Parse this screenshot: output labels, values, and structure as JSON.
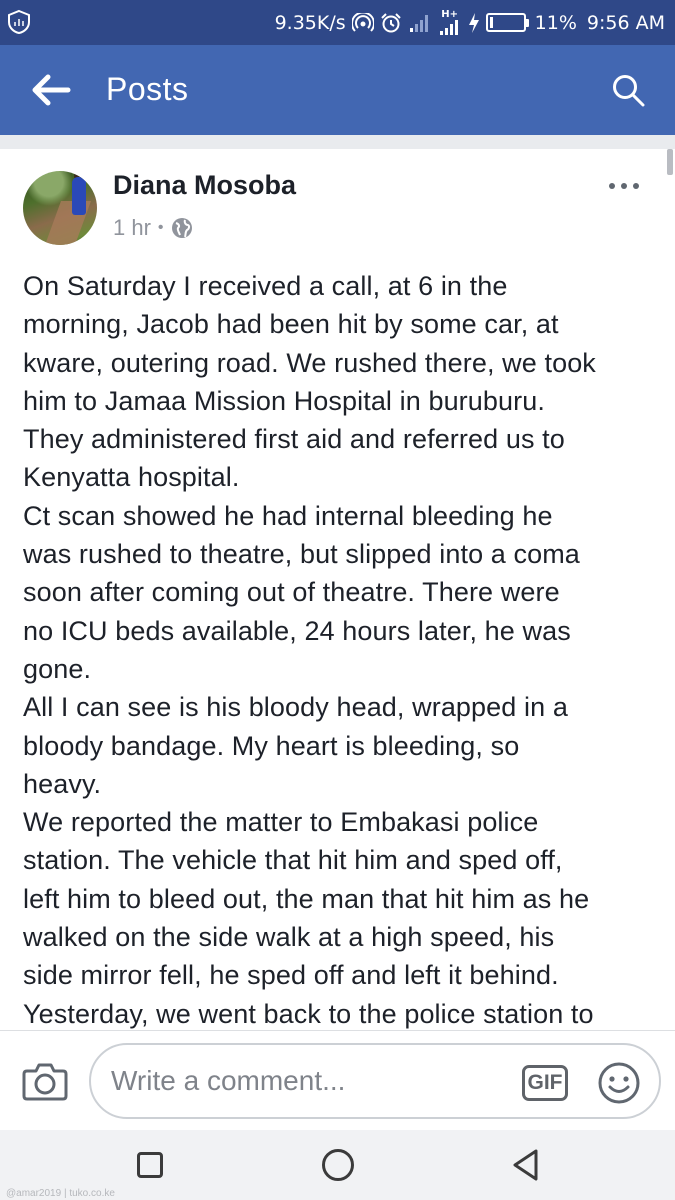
{
  "status_bar": {
    "speed": "9.35K/s",
    "network": "H+",
    "battery_percent": "11%",
    "battery_level": 0.11,
    "time": "9:56 AM"
  },
  "app_bar": {
    "title": "Posts",
    "back_icon": "arrow-left-icon",
    "search_icon": "search-icon"
  },
  "post": {
    "author": "Diana Mosoba",
    "timestamp": "1 hr",
    "separator": "•",
    "privacy_icon": "globe-icon",
    "lines": [
      "On Saturday I received a call, at 6 in the",
      "morning, Jacob had been hit by some car, at",
      "kware, outering road. We rushed there, we took",
      "him to Jamaa Mission Hospital in buruburu.",
      "They administered first aid and referred us to",
      "Kenyatta hospital.",
      "Ct scan showed he had internal bleeding he",
      "was rushed to theatre, but slipped into a coma",
      "soon after coming out of theatre. There were",
      "no ICU beds available, 24 hours later, he was",
      "gone.",
      "All I can see is his bloody head, wrapped in a",
      "bloody bandage. My heart is bleeding, so",
      "heavy.",
      "We reported the matter to Embakasi police",
      "station. The vehicle that hit him and sped off,",
      "left him to bleed out, the man that hit him as he",
      "walked on the side walk at a high speed, his",
      "side mirror fell, he sped off and left it behind.",
      "Yesterday, we went back to the police station to"
    ]
  },
  "comment_bar": {
    "placeholder": "Write a comment...",
    "gif_label": "GIF",
    "camera_icon": "camera-icon",
    "emoji_icon": "emoji-icon"
  },
  "nav_bar": {
    "recents_icon": "square-icon",
    "home_icon": "circle-icon",
    "back_icon": "triangle-back-icon"
  },
  "watermark": "@amar2019 | tuko.co.ke",
  "colors": {
    "status_bar": "#2f4888",
    "app_bar": "#4267b2",
    "text": "#1d2129",
    "meta": "#90949c"
  }
}
